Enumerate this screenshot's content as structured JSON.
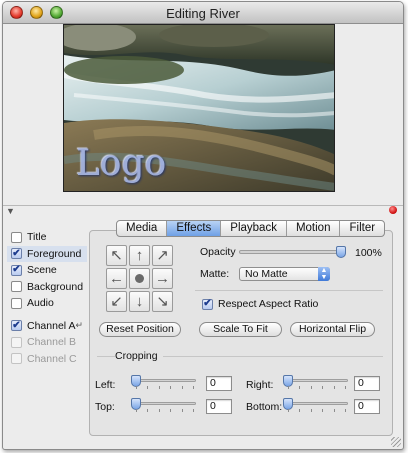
{
  "window": {
    "title": "Editing River"
  },
  "preview": {
    "logo_text": "Logo"
  },
  "tracks": [
    {
      "label": "Title",
      "checked": false,
      "enabled": true,
      "selected": false
    },
    {
      "label": "Foreground",
      "checked": true,
      "enabled": true,
      "selected": true
    },
    {
      "label": "Scene",
      "checked": true,
      "enabled": true,
      "selected": false
    },
    {
      "label": "Background",
      "checked": false,
      "enabled": true,
      "selected": false
    },
    {
      "label": "Audio",
      "checked": false,
      "enabled": true,
      "selected": false
    },
    {
      "label": "Channel A",
      "checked": true,
      "enabled": true,
      "selected": false
    },
    {
      "label": "Channel B",
      "checked": false,
      "enabled": false,
      "selected": false
    },
    {
      "label": "Channel C",
      "checked": false,
      "enabled": false,
      "selected": false
    }
  ],
  "tabs": [
    {
      "label": "Media",
      "active": false
    },
    {
      "label": "Effects",
      "active": true
    },
    {
      "label": "Playback",
      "active": false
    },
    {
      "label": "Motion",
      "active": false
    },
    {
      "label": "Filter",
      "active": false
    }
  ],
  "effects": {
    "opacity_label": "Opacity",
    "opacity_value": "100%",
    "opacity_fraction": 1.0,
    "matte_label": "Matte:",
    "matte_value": "No Matte",
    "respect_aspect_label": "Respect Aspect Ratio",
    "respect_aspect_checked": true,
    "reset_position": "Reset Position",
    "scale_to_fit": "Scale To Fit",
    "horizontal_flip": "Horizontal Flip"
  },
  "cropping": {
    "heading": "Cropping",
    "left_label": "Left:",
    "left_value": "0",
    "right_label": "Right:",
    "right_value": "0",
    "top_label": "Top:",
    "top_value": "0",
    "bottom_label": "Bottom:",
    "bottom_value": "0"
  },
  "icons": {
    "direction_pad": [
      "arrow-up-left-icon",
      "arrow-up-icon",
      "arrow-up-right-icon",
      "arrow-left-icon",
      "center-dot-icon",
      "arrow-right-icon",
      "arrow-down-left-icon",
      "arrow-down-icon",
      "arrow-down-right-icon"
    ]
  },
  "colors": {
    "accent": "#6fa0e6",
    "status_led": "#d01010"
  }
}
